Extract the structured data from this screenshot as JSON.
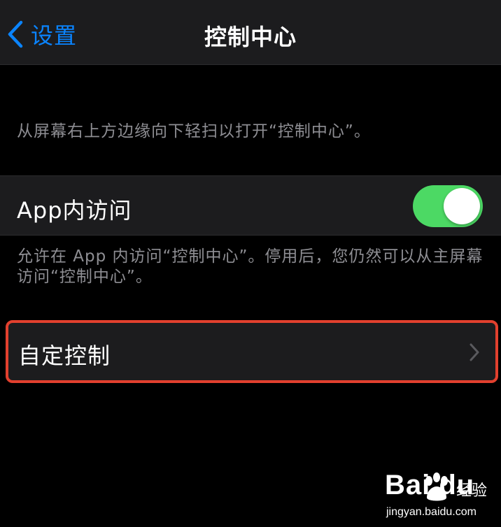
{
  "navbar": {
    "back_label": "设置",
    "title": "控制中心"
  },
  "notes": {
    "swipe_hint": "从屏幕右上方边缘向下轻扫以打开“控制中心”。",
    "app_access_hint": "允许在 App 内访问“控制中心”。停用后，您仍然可以从主屏幕访问“控制中心”。"
  },
  "settings": {
    "app_access": {
      "label": "App内访问",
      "enabled": true
    },
    "customize": {
      "label": "自定控制"
    }
  },
  "watermark": {
    "logo": "Bai du",
    "jingyan": "经验",
    "url": "jingyan.baidu.com"
  },
  "colors": {
    "accent": "#0a84ff",
    "toggle_on": "#4cd964",
    "highlight": "#e2402e",
    "background": "#000000",
    "cell": "#1c1c1e"
  }
}
